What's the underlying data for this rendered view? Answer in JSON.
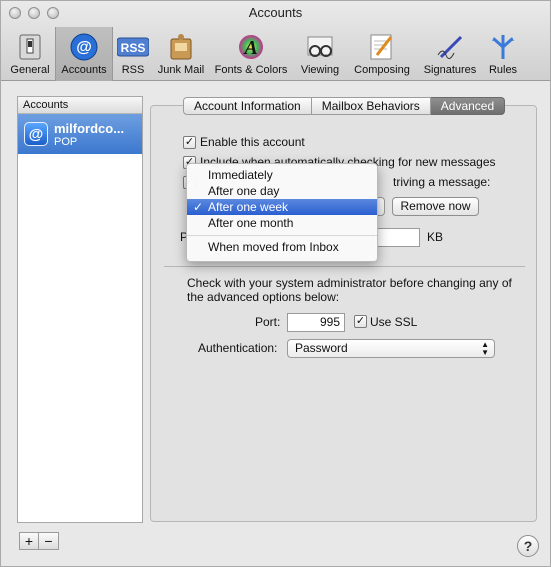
{
  "window": {
    "title": "Accounts"
  },
  "toolbar": {
    "items": [
      {
        "label": "General",
        "icon": "switch-icon"
      },
      {
        "label": "Accounts",
        "icon": "at-icon",
        "selected": true
      },
      {
        "label": "RSS",
        "icon": "rss-icon"
      },
      {
        "label": "Junk Mail",
        "icon": "junk-bin-icon"
      },
      {
        "label": "Fonts & Colors",
        "icon": "font-palette-icon"
      },
      {
        "label": "Viewing",
        "icon": "glasses-icon"
      },
      {
        "label": "Composing",
        "icon": "pencil-note-icon"
      },
      {
        "label": "Signatures",
        "icon": "signature-pen-icon"
      },
      {
        "label": "Rules",
        "icon": "rules-arrows-icon"
      }
    ]
  },
  "sidebar": {
    "header": "Accounts",
    "accounts": [
      {
        "name": "milfordco...",
        "type": "POP"
      }
    ],
    "add_label": "+",
    "remove_label": "−"
  },
  "tabs": [
    {
      "label": "Account Information",
      "active": false
    },
    {
      "label": "Mailbox Behaviors",
      "active": false
    },
    {
      "label": "Advanced",
      "active": true
    }
  ],
  "advanced": {
    "enable_account": {
      "label": "Enable this account",
      "checked": true
    },
    "include_auto_check": {
      "label": "Include when automatically checking for new messages",
      "checked": true
    },
    "remove_after": {
      "label": "triving a message:",
      "checked": true
    },
    "remove_now_label": "Remove now",
    "prompt_prefix": "P",
    "size_unit": "KB",
    "admin_note": "Check with your system administrator before changing any of the advanced options below:",
    "port_label": "Port:",
    "port_value": "995",
    "use_ssl": {
      "label": "Use SSL",
      "checked": true
    },
    "auth_label": "Authentication:",
    "auth_value": "Password"
  },
  "popup_menu": {
    "items": [
      {
        "label": "Immediately",
        "selected": false
      },
      {
        "label": "After one day",
        "selected": false
      },
      {
        "label": "After one week",
        "selected": true
      },
      {
        "label": "After one month",
        "selected": false
      },
      {
        "label": "When moved from Inbox",
        "selected": false
      }
    ],
    "check_glyph": "✓"
  },
  "help_label": "?"
}
